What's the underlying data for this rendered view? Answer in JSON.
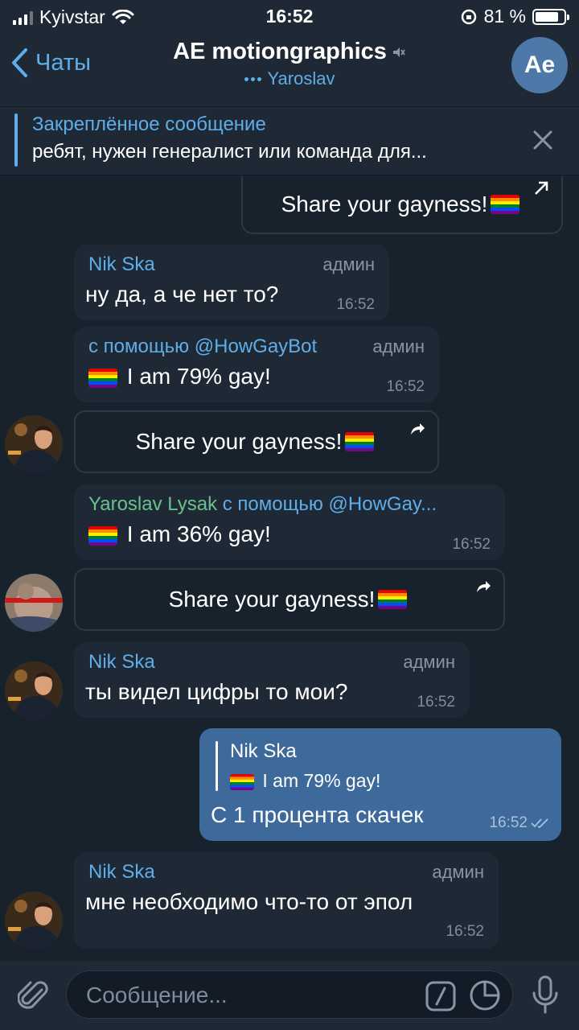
{
  "status_bar": {
    "carrier": "Kyivstar",
    "time": "16:52",
    "battery": "81 %",
    "battery_level": 0.81
  },
  "header": {
    "back_label": "Чаты",
    "title": "AE motiongraphics",
    "subtitle": "Yaroslav",
    "avatar_initials": "Ae"
  },
  "pinned": {
    "title": "Закреплённое сообщение",
    "text": "ребят, нужен генералист или команда для..."
  },
  "messages": [
    {
      "type": "button",
      "label": "Share your gayness!"
    },
    {
      "type": "text",
      "sender": "Nik Ska",
      "role": "админ",
      "text": "ну да, а че нет то?",
      "time": "16:52"
    },
    {
      "type": "bot",
      "via": "с помощью @HowGayBot",
      "role": "админ",
      "text": "I am 79% gay!",
      "time": "16:52"
    },
    {
      "type": "button",
      "label": "Share your gayness!"
    },
    {
      "type": "bot",
      "sender": "Yaroslav Lysak",
      "via": "с помощью @HowGay...",
      "text": "I am 36%  gay!",
      "time": "16:52"
    },
    {
      "type": "button",
      "label": "Share your gayness!"
    },
    {
      "type": "text",
      "sender": "Nik Ska",
      "role": "админ",
      "text": "ты видел цифры то мои?",
      "time": "16:52"
    },
    {
      "type": "outgoing",
      "reply_sender": "Nik Ska",
      "reply_text": "I am 79% gay!",
      "text": "С 1 процента скачек",
      "time": "16:52"
    },
    {
      "type": "text",
      "sender": "Nik Ska",
      "role": "админ",
      "text": "мне необходимо что-то от эпол",
      "time": "16:52"
    }
  ],
  "input": {
    "placeholder": "Сообщение..."
  },
  "colors": {
    "background": "#18222d",
    "bubble_in": "#1f2936",
    "bubble_out": "#3e6a9b",
    "accent": "#5eaeea",
    "green_name": "#69c28d"
  }
}
